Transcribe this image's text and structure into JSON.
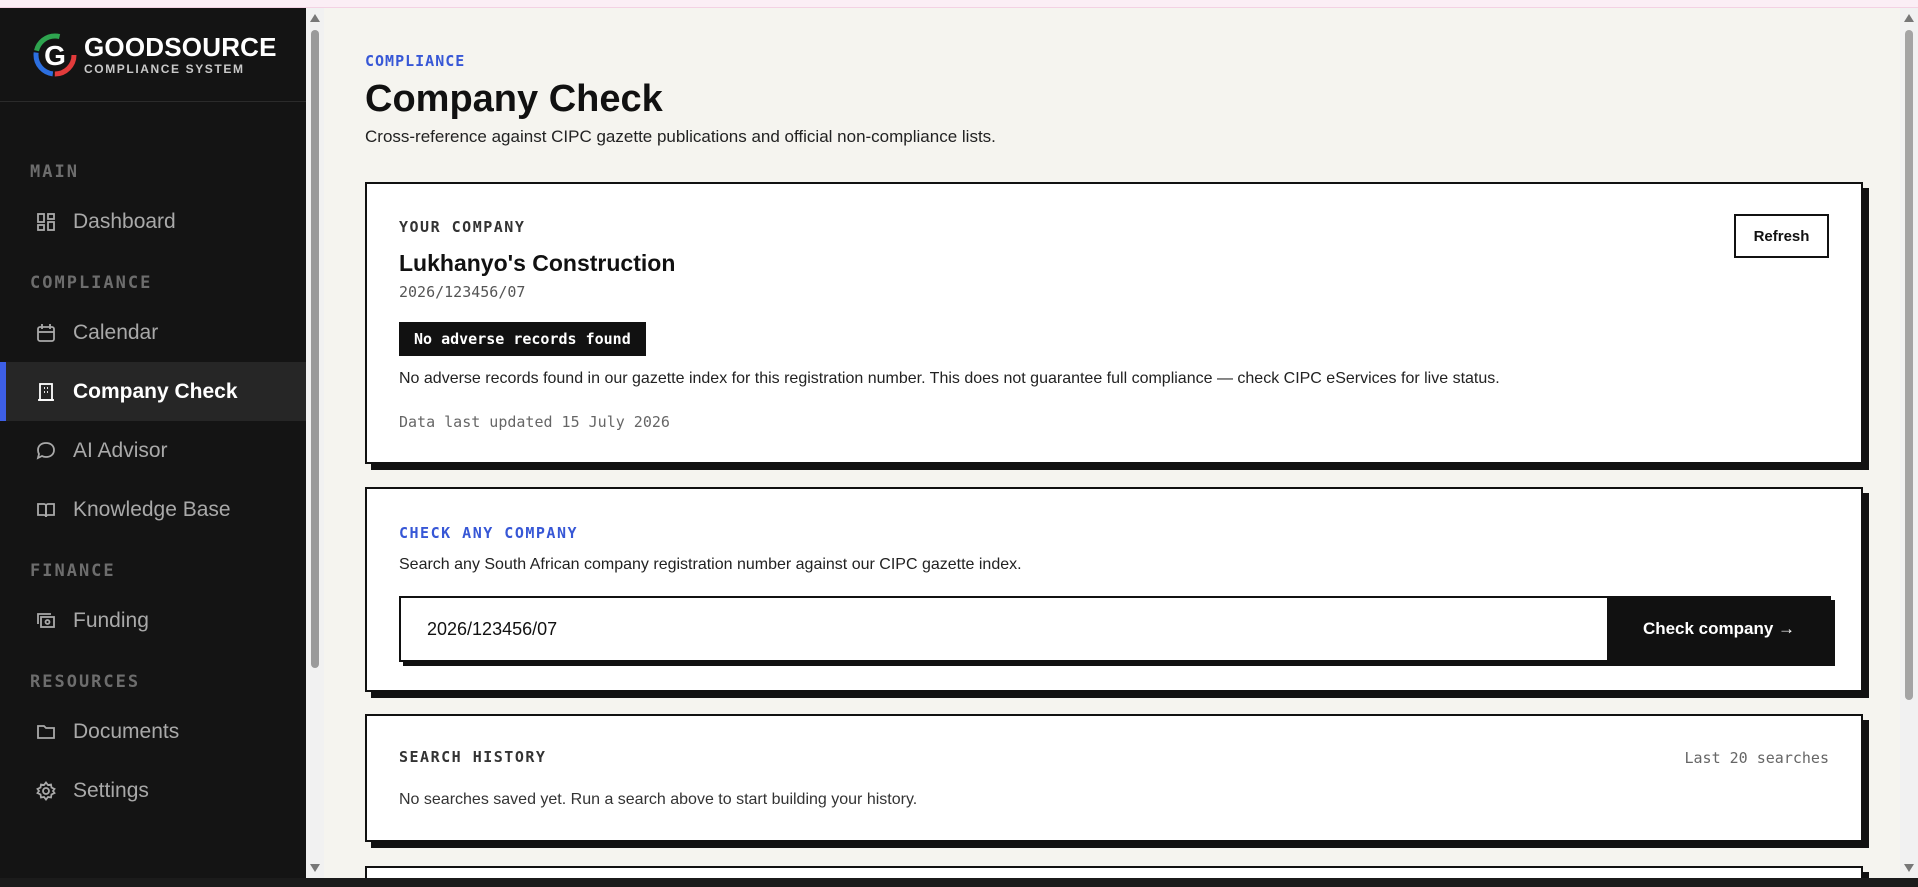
{
  "brand": {
    "name": "GOODSOURCE",
    "tagline": "COMPLIANCE SYSTEM"
  },
  "sidebar": {
    "sections": [
      {
        "label": "MAIN",
        "items": [
          {
            "label": "Dashboard",
            "icon": "dashboard-icon"
          }
        ]
      },
      {
        "label": "COMPLIANCE",
        "items": [
          {
            "label": "Calendar",
            "icon": "calendar-icon"
          },
          {
            "label": "Company Check",
            "icon": "building-icon",
            "active": true
          },
          {
            "label": "AI Advisor",
            "icon": "chat-icon"
          },
          {
            "label": "Knowledge Base",
            "icon": "book-icon"
          }
        ]
      },
      {
        "label": "FINANCE",
        "items": [
          {
            "label": "Funding",
            "icon": "money-icon"
          }
        ]
      },
      {
        "label": "RESOURCES",
        "items": [
          {
            "label": "Documents",
            "icon": "folder-icon"
          },
          {
            "label": "Settings",
            "icon": "gear-icon"
          }
        ]
      }
    ]
  },
  "page": {
    "breadcrumb": "COMPLIANCE",
    "title": "Company Check",
    "subtitle": "Cross-reference against CIPC gazette publications and official non-compliance lists."
  },
  "your_company": {
    "heading": "YOUR COMPANY",
    "refresh_label": "Refresh",
    "name": "Lukhanyo's Construction",
    "registration": "2026/123456/07",
    "badge": "No adverse records found",
    "note": "No adverse records found in our gazette index for this registration number. This does not guarantee full compliance — check CIPC eServices for live status.",
    "updated": "Data last updated 15 July 2026"
  },
  "check_any": {
    "heading": "CHECK ANY COMPANY",
    "description": "Search any South African company registration number against our CIPC gazette index.",
    "input_value": "2026/123456/07",
    "button_label": "Check company →"
  },
  "history": {
    "heading": "SEARCH HISTORY",
    "meta": "Last 20 searches",
    "empty": "No searches saved yet. Run a search above to start building your history."
  },
  "colors": {
    "accent": "#3d5fe6",
    "sidebar_bg": "#141414",
    "page_bg": "#f5f4ef"
  }
}
